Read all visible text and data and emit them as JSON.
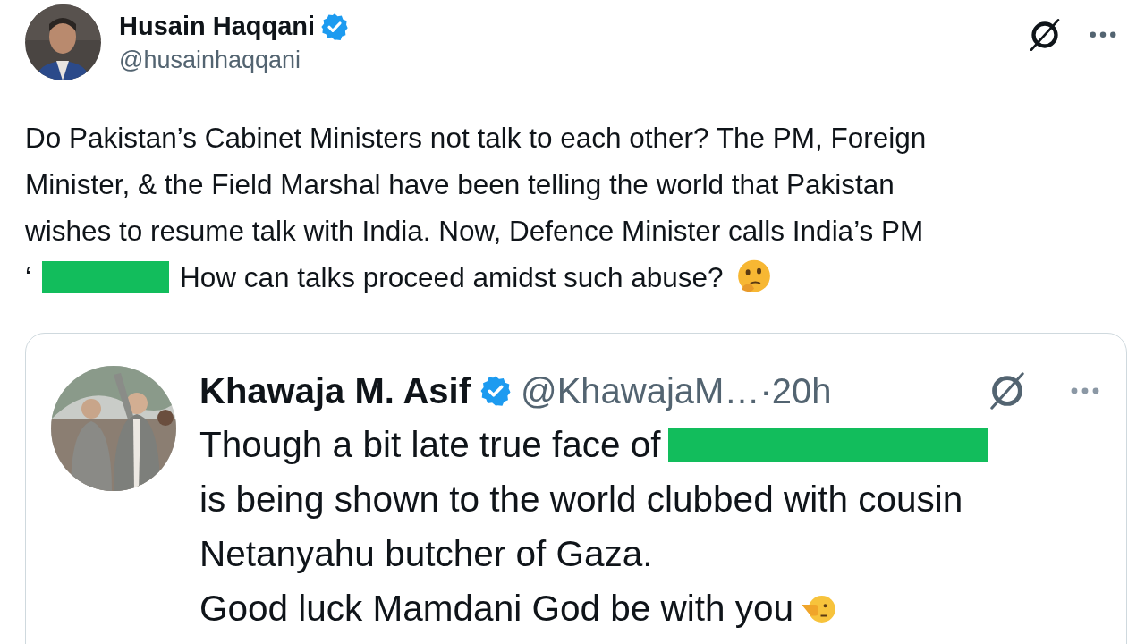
{
  "tweet": {
    "author": {
      "name": "Husain Haqqani",
      "handle": "@husainhaqqani",
      "verified": true
    },
    "lines": [
      {
        "segments": [
          {
            "kind": "text",
            "text": "Do Pakistan’s Cabinet Ministers not talk to each other? The PM, Foreign"
          }
        ]
      },
      {
        "segments": [
          {
            "kind": "text",
            "text": "Minister, & the Field Marshal have been telling the world that Pakistan"
          }
        ]
      },
      {
        "segments": [
          {
            "kind": "text",
            "text": "wishes to resume talk with India. Now, Defence Minister calls India’s PM"
          }
        ]
      },
      {
        "segments": [
          {
            "kind": "text",
            "text": "‘"
          },
          {
            "kind": "redaction"
          },
          {
            "kind": "text",
            "text": "How can talks proceed amidst such abuse?"
          },
          {
            "kind": "thinking"
          }
        ]
      }
    ],
    "quote": {
      "author": {
        "name": "Khawaja M. Asif",
        "handle": "@KhawajaM…",
        "time": "·20h",
        "verified": true
      },
      "lines": [
        {
          "segments": [
            {
              "kind": "text",
              "text": "Though a bit late true face of"
            },
            {
              "kind": "redaction"
            }
          ]
        },
        {
          "segments": [
            {
              "kind": "text",
              "text": "is being shown to the world clubbed with cousin"
            }
          ]
        },
        {
          "segments": [
            {
              "kind": "text",
              "text": "Netanyahu butcher of Gaza."
            }
          ]
        },
        {
          "segments": [
            {
              "kind": "text",
              "text": "Good luck Mamdani God be with you"
            },
            {
              "kind": "pointing"
            }
          ]
        }
      ]
    }
  }
}
